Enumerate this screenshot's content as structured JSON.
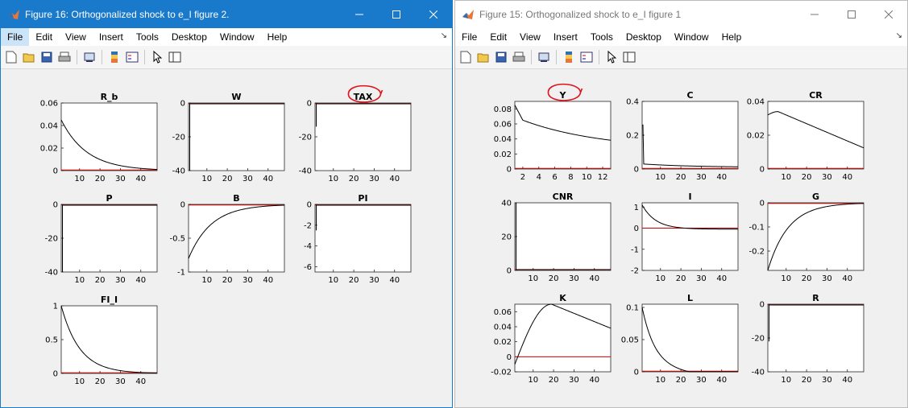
{
  "windows": [
    {
      "id": "win16",
      "title": "Figure 16: Orthogonalized shock to e_I figure 2.",
      "active": true,
      "plots": [
        {
          "title": "R_b",
          "col": 0,
          "row": 0,
          "xlim": [
            1,
            48
          ],
          "ylim": [
            0,
            0.06
          ],
          "xticks": [
            10,
            20,
            30,
            40
          ],
          "yticks": [
            0,
            0.02,
            0.04,
            0.06
          ],
          "yticklabels": [
            "0",
            "0.02",
            "0.04",
            "0.06"
          ],
          "curve": {
            "kind": "decay",
            "start": 0.045,
            "end": 0.0,
            "rate": 0.08
          }
        },
        {
          "title": "W",
          "col": 1,
          "row": 0,
          "xlim": [
            1,
            48
          ],
          "ylim": [
            -40,
            0
          ],
          "xticks": [
            10,
            20,
            30,
            40
          ],
          "yticks": [
            -40,
            -20,
            0
          ],
          "yticklabels": [
            "-40",
            "-20",
            "0"
          ],
          "curve": {
            "kind": "spike",
            "base": 0,
            "spike": -40
          }
        },
        {
          "title": "TAX",
          "col": 2,
          "row": 0,
          "xlim": [
            1,
            48
          ],
          "ylim": [
            -40,
            0
          ],
          "xticks": [
            10,
            20,
            30,
            40
          ],
          "yticks": [
            -40,
            -20,
            0
          ],
          "yticklabels": [
            "-40",
            "-20",
            "0"
          ],
          "curve": {
            "kind": "spike",
            "base": 0,
            "spike": -14
          },
          "circled": true
        },
        {
          "title": "P",
          "col": 0,
          "row": 1,
          "xlim": [
            1,
            48
          ],
          "ylim": [
            -40,
            0
          ],
          "xticks": [
            10,
            20,
            30,
            40
          ],
          "yticks": [
            -40,
            -20,
            0
          ],
          "yticklabels": [
            "-40",
            "-20",
            "0"
          ],
          "curve": {
            "kind": "spike",
            "base": 0,
            "spike": -40
          }
        },
        {
          "title": "B",
          "col": 1,
          "row": 1,
          "xlim": [
            1,
            48
          ],
          "ylim": [
            -1,
            0
          ],
          "xticks": [
            10,
            20,
            30,
            40
          ],
          "yticks": [
            -1,
            -0.5,
            0
          ],
          "yticklabels": [
            "-1",
            "-0.5",
            "0"
          ],
          "curve": {
            "kind": "decay",
            "start": -0.8,
            "end": 0.0,
            "rate": 0.09
          }
        },
        {
          "title": "PI",
          "col": 2,
          "row": 1,
          "xlim": [
            1,
            48
          ],
          "ylim": [
            -6.5,
            0
          ],
          "xticks": [
            10,
            20,
            30,
            40
          ],
          "yticks": [
            -6,
            -4,
            -2,
            0
          ],
          "yticklabels": [
            "-6",
            "-4",
            "-2",
            "0"
          ],
          "curve": {
            "kind": "spike",
            "base": 0,
            "spike": -2.5
          }
        },
        {
          "title": "FI_I",
          "col": 0,
          "row": 2,
          "xlim": [
            1,
            48
          ],
          "ylim": [
            0,
            1
          ],
          "xticks": [
            10,
            20,
            30,
            40
          ],
          "yticks": [
            0,
            0.5,
            1
          ],
          "yticklabels": [
            "0",
            "0.5",
            "1"
          ],
          "curve": {
            "kind": "decay",
            "start": 1.0,
            "end": 0.0,
            "rate": 0.11
          }
        }
      ]
    },
    {
      "id": "win15",
      "title": "Figure 15: Orthogonalized shock to e_I figure 1",
      "active": false,
      "plots": [
        {
          "title": "Y",
          "col": 0,
          "row": 0,
          "xlim": [
            1,
            13
          ],
          "ylim": [
            0,
            0.09
          ],
          "xticks": [
            2,
            4,
            6,
            8,
            10,
            12
          ],
          "yticks": [
            0,
            0.02,
            0.04,
            0.06,
            0.08
          ],
          "yticklabels": [
            "0",
            "0.02",
            "0.04",
            "0.06",
            "0.08"
          ],
          "curve": {
            "kind": "kinkdecay",
            "start": 0.085,
            "kink": 0.065,
            "end": 0.025
          },
          "circled": true
        },
        {
          "title": "C",
          "col": 1,
          "row": 0,
          "xlim": [
            1,
            48
          ],
          "ylim": [
            0,
            0.4
          ],
          "xticks": [
            10,
            20,
            30,
            40
          ],
          "yticks": [
            0,
            0.2,
            0.4
          ],
          "yticklabels": [
            "0",
            "0.2",
            "0.4"
          ],
          "curve": {
            "kind": "spikedecay",
            "spike": 0.26,
            "start": 0.03,
            "end": 0.01
          }
        },
        {
          "title": "CR",
          "col": 2,
          "row": 0,
          "xlim": [
            1,
            48
          ],
          "ylim": [
            0,
            0.04
          ],
          "xticks": [
            10,
            20,
            30,
            40
          ],
          "yticks": [
            0,
            0.02,
            0.04
          ],
          "yticklabels": [
            "0",
            "0.02",
            "0.04"
          ],
          "curve": {
            "kind": "hump",
            "start": 0.032,
            "peak": 0.034,
            "peakx": 6,
            "end": 0.0125
          }
        },
        {
          "title": "CNR",
          "col": 0,
          "row": 1,
          "xlim": [
            1,
            48
          ],
          "ylim": [
            0,
            40
          ],
          "xticks": [
            10,
            20,
            30,
            40
          ],
          "yticks": [
            0,
            20,
            40
          ],
          "yticklabels": [
            "0",
            "20",
            "40"
          ],
          "curve": {
            "kind": "spike",
            "base": 0,
            "spike": 40
          }
        },
        {
          "title": "I",
          "col": 1,
          "row": 1,
          "xlim": [
            1,
            48
          ],
          "ylim": [
            -2,
            1.2
          ],
          "xticks": [
            10,
            20,
            30,
            40
          ],
          "yticks": [
            -2,
            -1,
            0,
            1
          ],
          "yticklabels": [
            "-2",
            "-1",
            "0",
            "1"
          ],
          "curve": {
            "kind": "decay",
            "start": 1.1,
            "end": -0.05,
            "rate": 0.15
          }
        },
        {
          "title": "G",
          "col": 2,
          "row": 1,
          "xlim": [
            1,
            48
          ],
          "ylim": [
            -0.28,
            0
          ],
          "xticks": [
            10,
            20,
            30,
            40
          ],
          "yticks": [
            -0.2,
            -0.1,
            0
          ],
          "yticklabels": [
            "-0.2",
            "-0.1",
            "0"
          ],
          "curve": {
            "kind": "decay",
            "start": -0.28,
            "end": 0.0,
            "rate": 0.1
          }
        },
        {
          "title": "K",
          "col": 0,
          "row": 2,
          "xlim": [
            1,
            48
          ],
          "ylim": [
            -0.02,
            0.07
          ],
          "xticks": [
            10,
            20,
            30,
            40
          ],
          "yticks": [
            -0.02,
            0,
            0.02,
            0.04,
            0.06
          ],
          "yticklabels": [
            "-0.02",
            "0",
            "0.02",
            "0.04",
            "0.06"
          ],
          "curve": {
            "kind": "humpbig",
            "start": -0.01,
            "peak": 0.07,
            "peakx": 19,
            "end": 0.038
          }
        },
        {
          "title": "L",
          "col": 1,
          "row": 2,
          "xlim": [
            1,
            48
          ],
          "ylim": [
            0,
            0.105
          ],
          "xticks": [
            10,
            20,
            30,
            40
          ],
          "yticks": [
            0,
            0.05,
            0.1
          ],
          "yticklabels": [
            "0",
            "0.05",
            "0.1"
          ],
          "curve": {
            "kind": "decayunder",
            "start": 0.1,
            "end": 0.0,
            "rate": 0.15
          }
        },
        {
          "title": "R",
          "col": 2,
          "row": 2,
          "xlim": [
            1,
            48
          ],
          "ylim": [
            -40,
            0
          ],
          "xticks": [
            10,
            20,
            30,
            40
          ],
          "yticks": [
            -40,
            -20,
            0
          ],
          "yticklabels": [
            "-40",
            "-20",
            "0"
          ],
          "curve": {
            "kind": "spike",
            "base": 0,
            "spike": -22
          }
        }
      ]
    }
  ],
  "menu": [
    "File",
    "Edit",
    "View",
    "Insert",
    "Tools",
    "Desktop",
    "Window",
    "Help"
  ],
  "colors": {
    "active_title": "#1979ca",
    "zero_line": "#cc0000",
    "curve": "#000000",
    "annotation": "#e0121a"
  },
  "toolbar_icons": [
    "new-figure-icon",
    "open-icon",
    "save-icon",
    "print-icon",
    "link-icon",
    "insert-colorbar-icon",
    "insert-legend-icon",
    "pointer-icon",
    "property-inspector-icon"
  ]
}
